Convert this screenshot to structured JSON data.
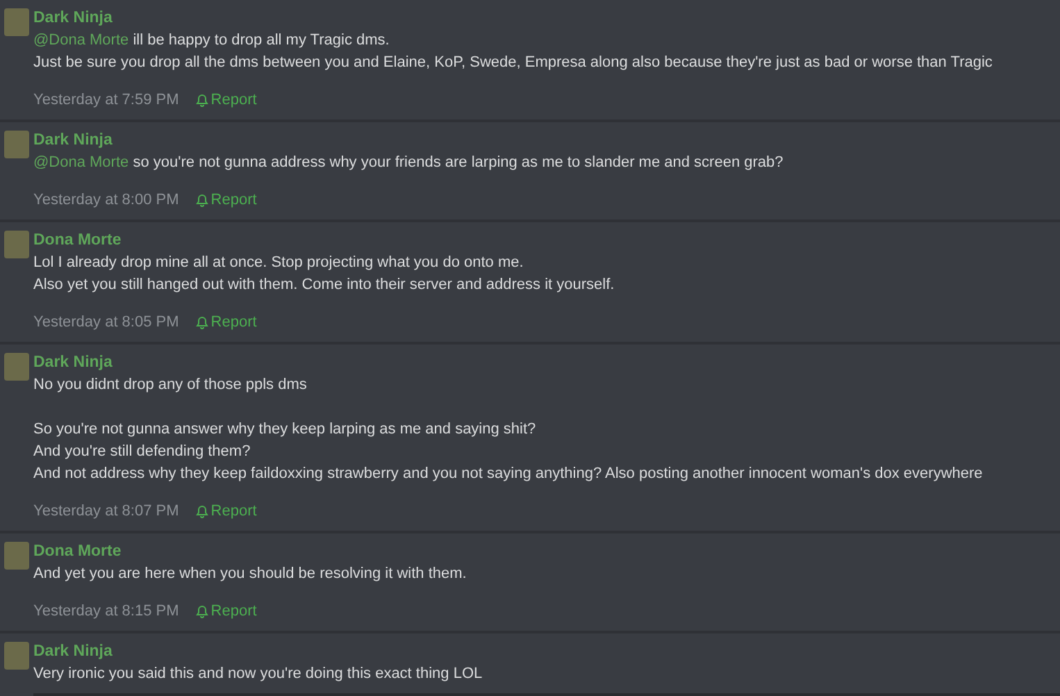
{
  "messages": [
    {
      "author": "Dark Ninja",
      "paragraphs": [
        [
          {
            "mention": "@Dona Morte",
            "text": "ill be happy to drop all my Tragic dms."
          },
          {
            "text": "Just be sure you drop all the dms between you and Elaine, KoP, Swede, Empresa along also because they're just as bad or worse than Tragic"
          }
        ]
      ],
      "time": "Yesterday at 7:59 PM",
      "report": "Report"
    },
    {
      "author": "Dark Ninja",
      "paragraphs": [
        [
          {
            "mention": "@Dona Morte",
            "text": "so you're not gunna address why your friends are larping as me to slander me and screen grab?"
          }
        ]
      ],
      "time": "Yesterday at 8:00 PM",
      "report": "Report"
    },
    {
      "author": "Dona Morte",
      "paragraphs": [
        [
          {
            "text": "Lol I already drop mine all at once. Stop projecting what you do onto me."
          },
          {
            "text": "Also yet you still hanged out with them. Come into their server and address it yourself."
          }
        ]
      ],
      "time": "Yesterday at 8:05 PM",
      "report": "Report"
    },
    {
      "author": "Dark Ninja",
      "paragraphs": [
        [
          {
            "text": "No you didnt drop any of those ppls dms"
          }
        ],
        [
          {
            "text": "So you're not gunna answer why they keep larping as me and saying shit?"
          },
          {
            "text": "And you're still defending them?"
          },
          {
            "text": "And not address why they keep faildoxxing strawberry and you not saying anything? Also posting another innocent woman's dox everywhere"
          }
        ]
      ],
      "time": "Yesterday at 8:07 PM",
      "report": "Report"
    },
    {
      "author": "Dona Morte",
      "paragraphs": [
        [
          {
            "text": "And yet you are here when you should be resolving it with them."
          }
        ]
      ],
      "time": "Yesterday at 8:15 PM",
      "report": "Report"
    },
    {
      "author": "Dark Ninja",
      "paragraphs": [
        [
          {
            "text": "Very ironic you said this and now you're doing this exact thing LOL"
          }
        ]
      ]
    }
  ]
}
